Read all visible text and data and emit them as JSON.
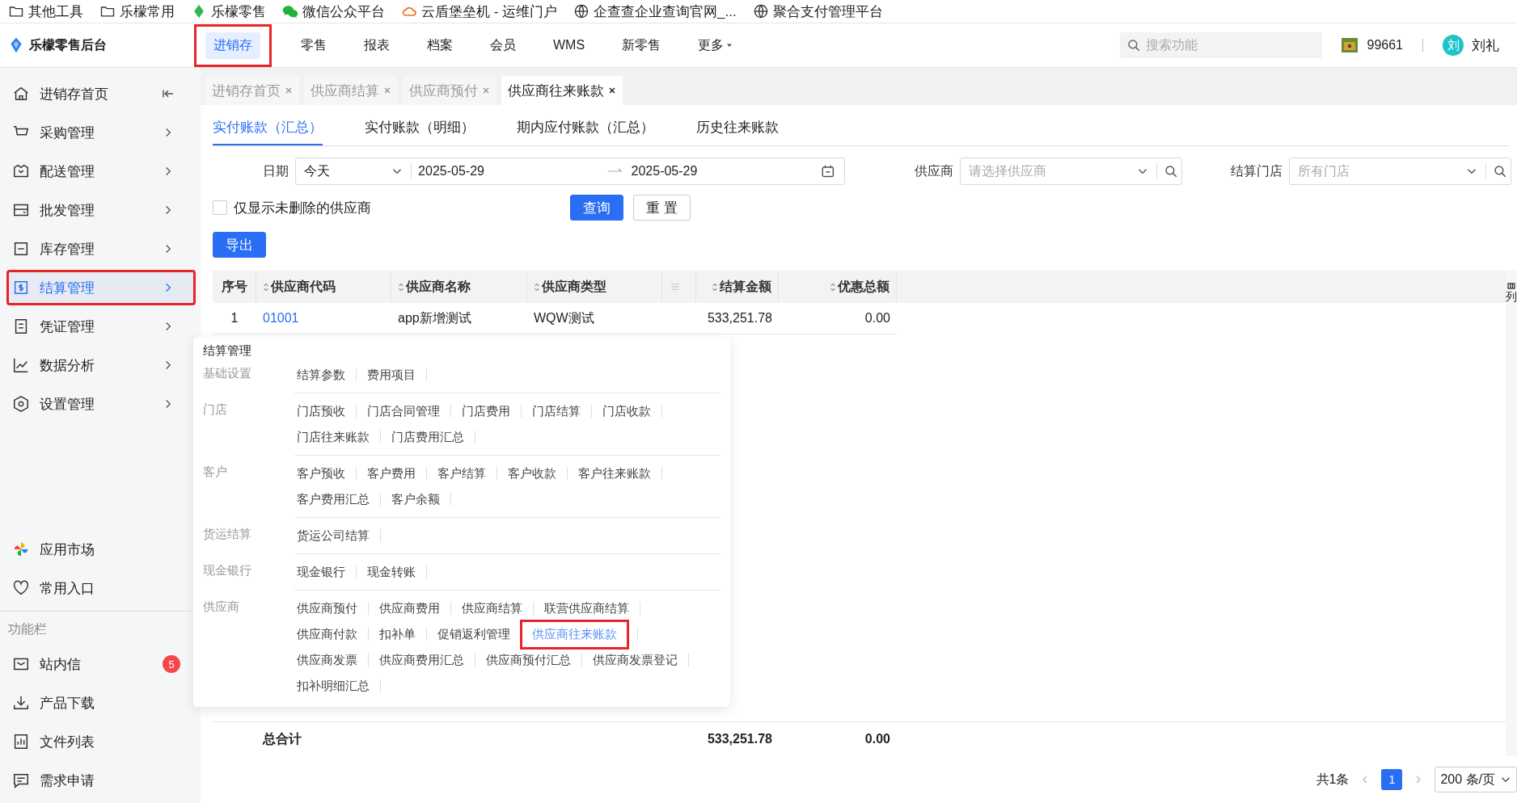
{
  "bookmarks": [
    {
      "kind": "folder",
      "label": "其他工具"
    },
    {
      "kind": "folder",
      "label": "乐檬常用"
    },
    {
      "kind": "leaf",
      "label": "乐檬零售"
    },
    {
      "kind": "chat",
      "label": "微信公众平台"
    },
    {
      "kind": "cloud",
      "label": "云盾堡垒机 - 运维门户"
    },
    {
      "kind": "globe",
      "label": "企查查企业查询官网_..."
    },
    {
      "kind": "globe",
      "label": "聚合支付管理平台"
    }
  ],
  "app": {
    "title": "乐檬零售后台"
  },
  "top_nav": [
    {
      "label": "进销存",
      "selected": true,
      "highlighted": true
    },
    {
      "label": "零售",
      "selected": false,
      "highlighted": false
    },
    {
      "label": "报表",
      "selected": false,
      "highlighted": false
    },
    {
      "label": "档案",
      "selected": false,
      "highlighted": false
    },
    {
      "label": "会员",
      "selected": false,
      "highlighted": false
    },
    {
      "label": "WMS",
      "selected": false,
      "highlighted": false
    },
    {
      "label": "新零售",
      "selected": false,
      "highlighted": false
    },
    {
      "label": "更多",
      "selected": false,
      "highlighted": false,
      "dropdown": true
    }
  ],
  "search": {
    "placeholder": "搜索功能"
  },
  "user": {
    "points": "99661",
    "avatar": "刘",
    "name": "刘礼"
  },
  "sidebar": {
    "items": [
      {
        "label": "进销存首页",
        "selected": false,
        "highlighted": false,
        "kind": "collapse"
      },
      {
        "label": "采购管理",
        "selected": false,
        "highlighted": false,
        "kind": "menu"
      },
      {
        "label": "配送管理",
        "selected": false,
        "highlighted": false,
        "kind": "menu"
      },
      {
        "label": "批发管理",
        "selected": false,
        "highlighted": false,
        "kind": "menu"
      },
      {
        "label": "库存管理",
        "selected": false,
        "highlighted": false,
        "kind": "menu"
      },
      {
        "label": "结算管理",
        "selected": true,
        "highlighted": true,
        "kind": "menu"
      },
      {
        "label": "凭证管理",
        "selected": false,
        "highlighted": false,
        "kind": "menu"
      },
      {
        "label": "数据分析",
        "selected": false,
        "highlighted": false,
        "kind": "menu"
      },
      {
        "label": "设置管理",
        "selected": false,
        "highlighted": false,
        "kind": "menu"
      }
    ],
    "extras": [
      {
        "label": "应用市场"
      },
      {
        "label": "常用入口"
      }
    ],
    "section_label": "功能栏",
    "tools": [
      {
        "label": "站内信",
        "badge": "5"
      },
      {
        "label": "产品下载"
      },
      {
        "label": "文件列表"
      },
      {
        "label": "需求申请"
      }
    ]
  },
  "page_tabs": [
    {
      "label": "进销存首页",
      "selected": false
    },
    {
      "label": "供应商结算",
      "selected": false
    },
    {
      "label": "供应商预付",
      "selected": false
    },
    {
      "label": "供应商往来账款",
      "selected": true
    }
  ],
  "sub_tabs": [
    {
      "label": "实付账款（汇总）",
      "selected": true
    },
    {
      "label": "实付账款（明细）",
      "selected": false
    },
    {
      "label": "期内应付账款（汇总）",
      "selected": false
    },
    {
      "label": "历史往来账款",
      "selected": false
    }
  ],
  "filters": {
    "date_label": "日期",
    "date_preset": "今天",
    "date_start": "2025-05-29",
    "date_end": "2025-05-29",
    "supplier_label": "供应商",
    "supplier_placeholder": "请选择供应商",
    "store_label": "结算门店",
    "store_placeholder": "所有门店"
  },
  "checkbox": {
    "label": "仅显示未删除的供应商",
    "checked": false
  },
  "buttons": {
    "query": "查询",
    "reset": "重 置",
    "export": "导出"
  },
  "table": {
    "columns": [
      "序号",
      "供应商代码",
      "供应商名称",
      "供应商类型",
      "结算金额",
      "优惠总额"
    ],
    "rows": [
      [
        "1",
        "01001",
        "app新增测试",
        "WQW测试",
        "533,251.78",
        "0.00"
      ]
    ],
    "total": {
      "label": "总合计",
      "amount": "533,251.78",
      "discount": "0.00"
    },
    "column_settings": "列"
  },
  "pagination": {
    "total": "共1条",
    "pages": [
      {
        "label": "1",
        "selected": true
      }
    ],
    "page_size": "200 条/页"
  },
  "popup_menu": {
    "title": "结算管理",
    "groups": [
      {
        "label": "基础设置",
        "links": [
          {
            "label": "结算参数",
            "selected": false
          },
          {
            "label": "费用项目",
            "selected": false
          }
        ]
      },
      {
        "label": "门店",
        "links": [
          {
            "label": "门店预收",
            "selected": false
          },
          {
            "label": "门店合同管理",
            "selected": false
          },
          {
            "label": "门店费用",
            "selected": false
          },
          {
            "label": "门店结算",
            "selected": false
          },
          {
            "label": "门店收款",
            "selected": false
          },
          {
            "label": "门店往来账款",
            "selected": false
          },
          {
            "label": "门店费用汇总",
            "selected": false
          }
        ]
      },
      {
        "label": "客户",
        "links": [
          {
            "label": "客户预收",
            "selected": false
          },
          {
            "label": "客户费用",
            "selected": false
          },
          {
            "label": "客户结算",
            "selected": false
          },
          {
            "label": "客户收款",
            "selected": false
          },
          {
            "label": "客户往来账款",
            "selected": false
          },
          {
            "label": "客户费用汇总",
            "selected": false
          },
          {
            "label": "客户余额",
            "selected": false
          }
        ]
      },
      {
        "label": "货运结算",
        "links": [
          {
            "label": "货运公司结算",
            "selected": false
          }
        ]
      },
      {
        "label": "现金银行",
        "links": [
          {
            "label": "现金银行",
            "selected": false
          },
          {
            "label": "现金转账",
            "selected": false
          }
        ]
      },
      {
        "label": "供应商",
        "links": [
          {
            "label": "供应商预付",
            "selected": false
          },
          {
            "label": "供应商费用",
            "selected": false
          },
          {
            "label": "供应商结算",
            "selected": false
          },
          {
            "label": "联营供应商结算",
            "selected": false
          },
          {
            "label": "供应商付款",
            "selected": false
          },
          {
            "label": "扣补单",
            "selected": false
          },
          {
            "label": "促销返利管理",
            "selected": false
          },
          {
            "label": "供应商往来账款",
            "selected": true,
            "highlighted": true
          },
          {
            "label": "供应商发票",
            "selected": false
          },
          {
            "label": "供应商费用汇总",
            "selected": false
          },
          {
            "label": "供应商预付汇总",
            "selected": false
          },
          {
            "label": "供应商发票登记",
            "selected": false
          },
          {
            "label": "扣补明细汇总",
            "selected": false
          }
        ]
      }
    ]
  }
}
